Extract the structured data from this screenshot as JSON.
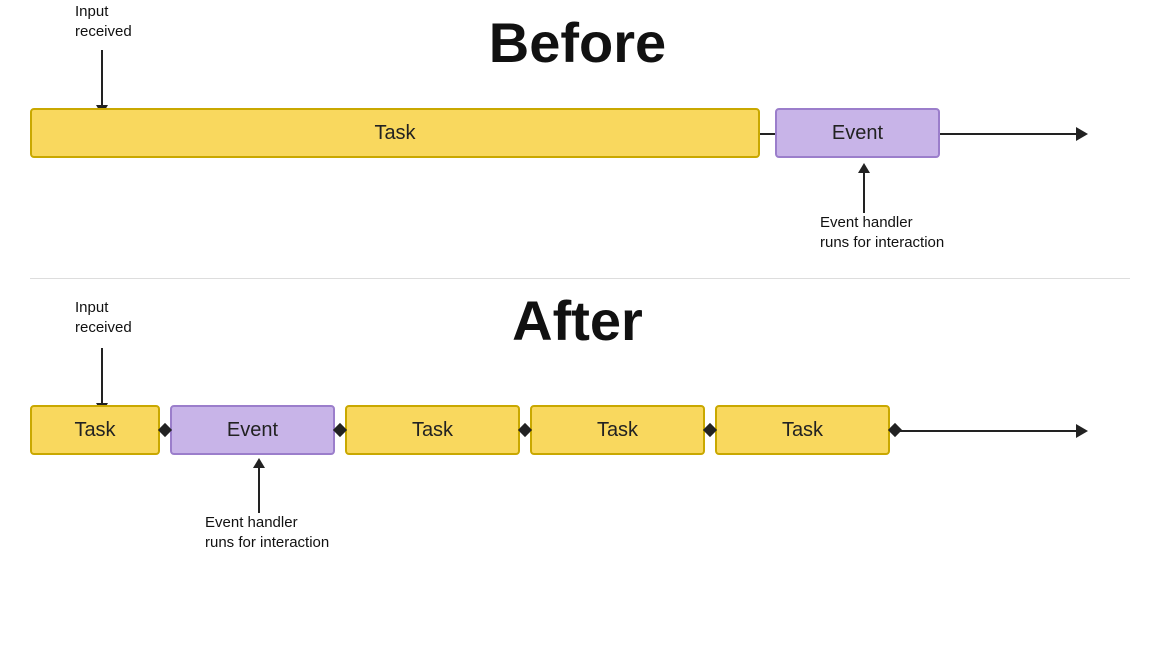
{
  "before": {
    "title": "Before",
    "input_label_line1": "Input",
    "input_label_line2": "received",
    "task_label": "Task",
    "event_label": "Event",
    "event_handler_line1": "Event handler",
    "event_handler_line2": "runs for interaction"
  },
  "after": {
    "title": "After",
    "input_label_line1": "Input",
    "input_label_line2": "received",
    "task_label": "Task",
    "event_label": "Event",
    "task2_label": "Task",
    "task3_label": "Task",
    "task4_label": "Task",
    "event_handler_line1": "Event handler",
    "event_handler_line2": "runs for interaction"
  }
}
